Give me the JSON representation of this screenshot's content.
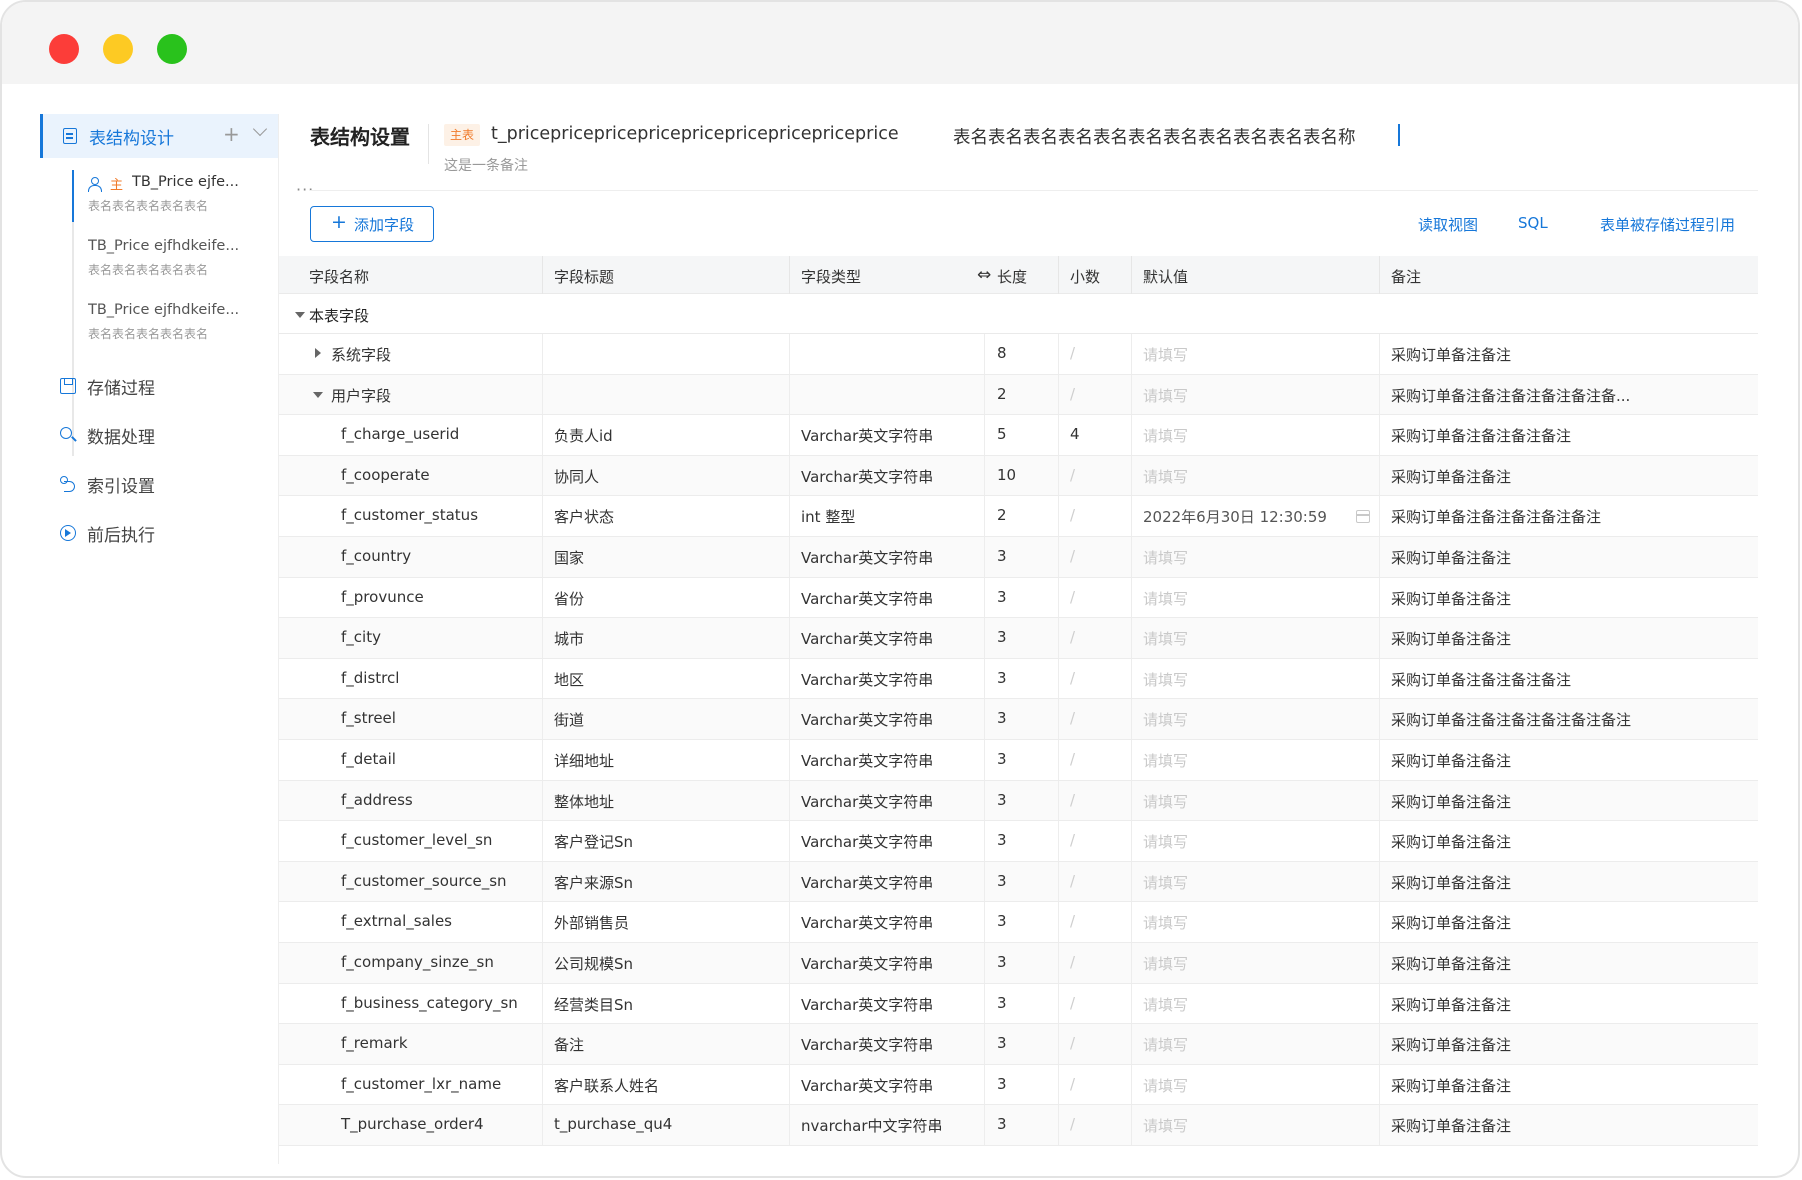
{
  "sidebar": {
    "design_label": "表结构设计",
    "tables": [
      {
        "name": "TB_Price ejfe...",
        "sub": "表名表名表名表名表名",
        "main_mark": "主",
        "active": true
      },
      {
        "name": "TB_Price ejfhdkeife...",
        "sub": "表名表名表名表名表名"
      },
      {
        "name": "TB_Price ejfhdkeife...",
        "sub": "表名表名表名表名表名"
      }
    ],
    "nav": [
      {
        "label": "存储过程",
        "icon": "save-icon"
      },
      {
        "label": "数据处理",
        "icon": "wrench-icon"
      },
      {
        "label": "索引设置",
        "icon": "route-icon"
      },
      {
        "label": "前后执行",
        "icon": "play-icon"
      }
    ]
  },
  "header": {
    "title": "表结构设置",
    "main_tag": "主表",
    "table_code": "t_pricepricepricepricepricepricepricepriceprice",
    "table_name": "表名表名表名表名表名表名表名表名表名表名表名称",
    "note": "这是一条备注"
  },
  "toolbar": {
    "add_label": "添加字段",
    "links": [
      "读取视图",
      "SQL",
      "表单被存储过程引用"
    ]
  },
  "table": {
    "columns": [
      "字段名称",
      "字段标题",
      "字段类型",
      "长度",
      "小数",
      "默认值",
      "备注"
    ],
    "group_label": "本表字段",
    "sub_groups": [
      {
        "name": "系统字段",
        "length": "8",
        "decimal": "/",
        "default": "请填写",
        "remark": "采购订单备注备注",
        "expanded": false
      },
      {
        "name": "用户字段",
        "length": "2",
        "decimal": "/",
        "default": "请填写",
        "remark": "采购订单备注备注备注备注备注备...",
        "expanded": true
      }
    ],
    "rows": [
      {
        "name": "f_charge_userid",
        "title": "负责人id",
        "type": "Varchar英文字符串",
        "length": "5",
        "decimal": "4",
        "default": "请填写",
        "remark": "采购订单备注备注备注备注"
      },
      {
        "name": "f_cooperate",
        "title": "协同人",
        "type": "Varchar英文字符串",
        "length": "10",
        "decimal": "/",
        "default": "请填写",
        "remark": "采购订单备注备注"
      },
      {
        "name": "f_customer_status",
        "title": "客户状态",
        "type": "int 整型",
        "length": "2",
        "decimal": "/",
        "default": "2022年6月30日   12:30:59",
        "remark": "采购订单备注备注备注备注备注",
        "date": true
      },
      {
        "name": "f_country",
        "title": "国家",
        "type": "Varchar英文字符串",
        "length": "3",
        "decimal": "/",
        "default": "请填写",
        "remark": "采购订单备注备注"
      },
      {
        "name": "f_provunce",
        "title": "省份",
        "type": "Varchar英文字符串",
        "length": "3",
        "decimal": "/",
        "default": "请填写",
        "remark": "采购订单备注备注"
      },
      {
        "name": "f_city",
        "title": "城市",
        "type": "Varchar英文字符串",
        "length": "3",
        "decimal": "/",
        "default": "请填写",
        "remark": "采购订单备注备注"
      },
      {
        "name": "f_distrcl",
        "title": "地区",
        "type": "Varchar英文字符串",
        "length": "3",
        "decimal": "/",
        "default": "请填写",
        "remark": "采购订单备注备注备注备注"
      },
      {
        "name": "f_streel",
        "title": "街道",
        "type": "Varchar英文字符串",
        "length": "3",
        "decimal": "/",
        "default": "请填写",
        "remark": "采购订单备注备注备注备注备注备注"
      },
      {
        "name": "f_detail",
        "title": "详细地址",
        "type": "Varchar英文字符串",
        "length": "3",
        "decimal": "/",
        "default": "请填写",
        "remark": "采购订单备注备注"
      },
      {
        "name": "f_address",
        "title": "整体地址",
        "type": "Varchar英文字符串",
        "length": "3",
        "decimal": "/",
        "default": "请填写",
        "remark": "采购订单备注备注"
      },
      {
        "name": "f_customer_level_sn",
        "title": "客户登记Sn",
        "type": "Varchar英文字符串",
        "length": "3",
        "decimal": "/",
        "default": "请填写",
        "remark": "采购订单备注备注"
      },
      {
        "name": "f_customer_source_sn",
        "title": "客户来源Sn",
        "type": "Varchar英文字符串",
        "length": "3",
        "decimal": "/",
        "default": "请填写",
        "remark": "采购订单备注备注"
      },
      {
        "name": "f_extrnal_sales",
        "title": "外部销售员",
        "type": "Varchar英文字符串",
        "length": "3",
        "decimal": "/",
        "default": "请填写",
        "remark": "采购订单备注备注"
      },
      {
        "name": "f_company_sinze_sn",
        "title": "公司规模Sn",
        "type": "Varchar英文字符串",
        "length": "3",
        "decimal": "/",
        "default": "请填写",
        "remark": "采购订单备注备注"
      },
      {
        "name": "f_business_category_sn",
        "title": "经营类目Sn",
        "type": "Varchar英文字符串",
        "length": "3",
        "decimal": "/",
        "default": "请填写",
        "remark": "采购订单备注备注"
      },
      {
        "name": "f_remark",
        "title": "备注",
        "type": "Varchar英文字符串",
        "length": "3",
        "decimal": "/",
        "default": "请填写",
        "remark": "采购订单备注备注"
      },
      {
        "name": "f_customer_lxr_name",
        "title": "客户联系人姓名",
        "type": "Varchar英文字符串",
        "length": "3",
        "decimal": "/",
        "default": "请填写",
        "remark": "采购订单备注备注"
      },
      {
        "name": "T_purchase_order4",
        "title": "t_purchase_qu4",
        "type": "nvarchar中文字符串",
        "length": "3",
        "decimal": "/",
        "default": "请填写",
        "remark": "采购订单备注备注"
      }
    ]
  }
}
